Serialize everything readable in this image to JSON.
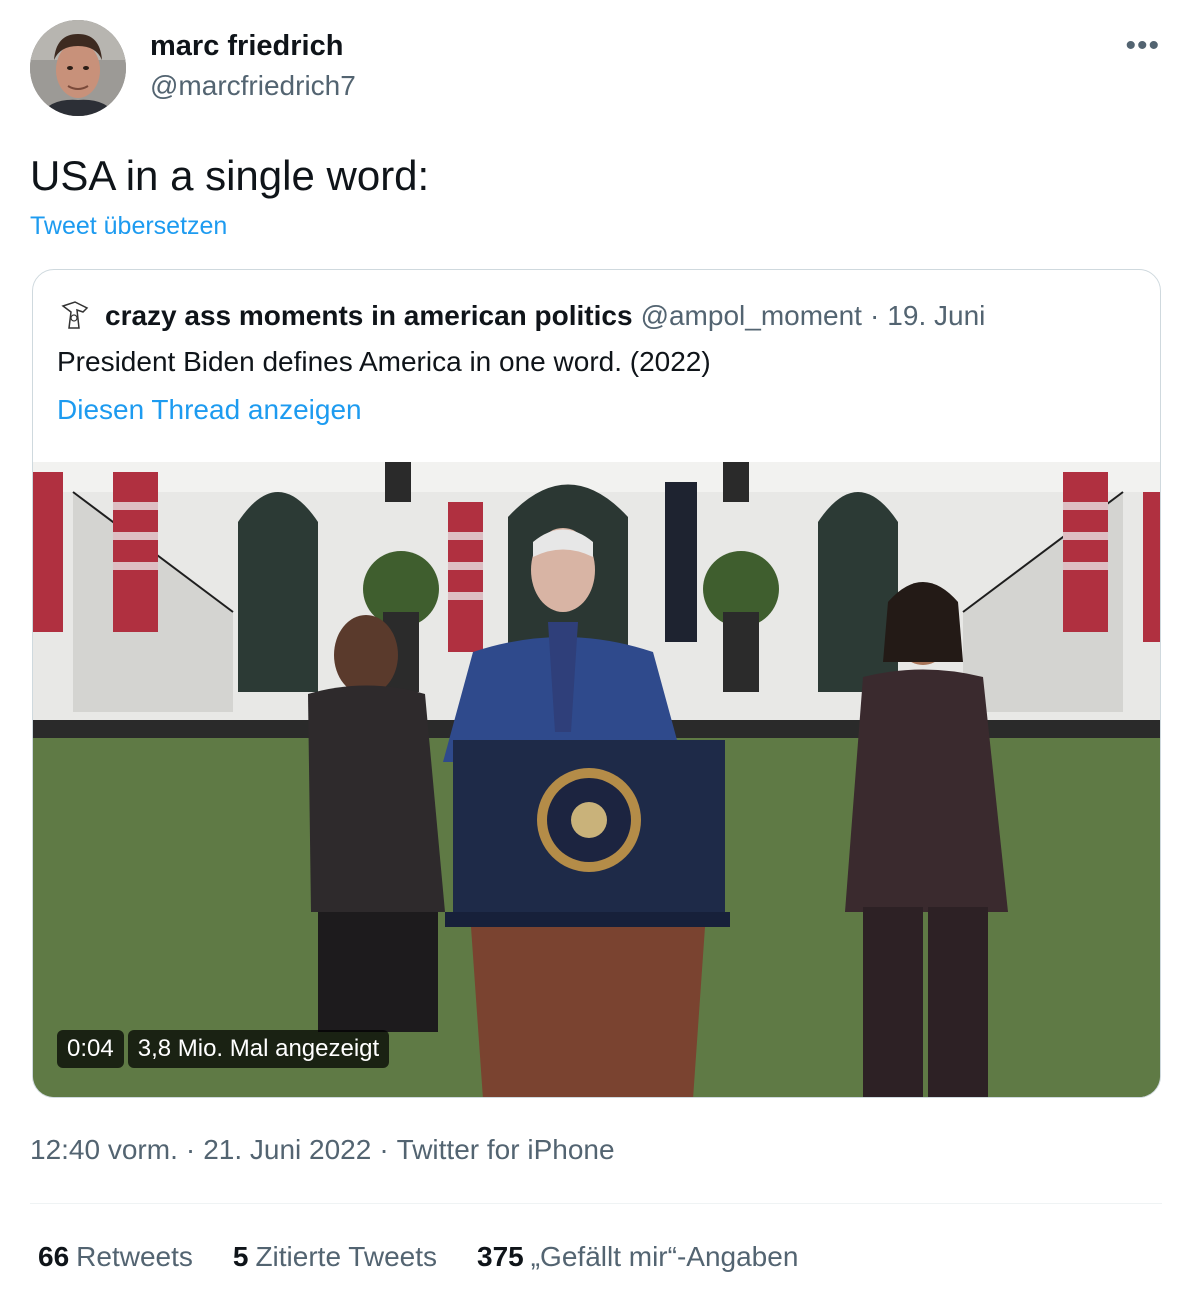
{
  "author": {
    "name": "marc friedrich",
    "handle": "@marcfriedrich7"
  },
  "more_icon": "more-horizontal-icon",
  "tweet": {
    "text": "USA in a single word:",
    "translate_label": "Tweet übersetzen"
  },
  "quote": {
    "name": "crazy ass moments in american politics",
    "handle": "@ampol_moment",
    "separator": "·",
    "date": "19. Juni",
    "text": "President Biden defines America in one word. (2022)",
    "thread_link": "Diesen Thread anzeigen",
    "video": {
      "duration": "0:04",
      "views": "3,8 Mio. Mal angezeigt"
    }
  },
  "meta": {
    "time": "12:40 vorm.",
    "date": "21. Juni 2022",
    "source": "Twitter for iPhone",
    "separator": "·"
  },
  "stats": [
    {
      "count": "66",
      "label": "Retweets"
    },
    {
      "count": "5",
      "label": "Zitierte Tweets"
    },
    {
      "count": "375",
      "label": "„Gefällt mir“-Angaben"
    }
  ],
  "colors": {
    "link": "#1d9bf0",
    "secondary_text": "#536471",
    "primary_text": "#0f1419",
    "border": "#cfd9de"
  }
}
